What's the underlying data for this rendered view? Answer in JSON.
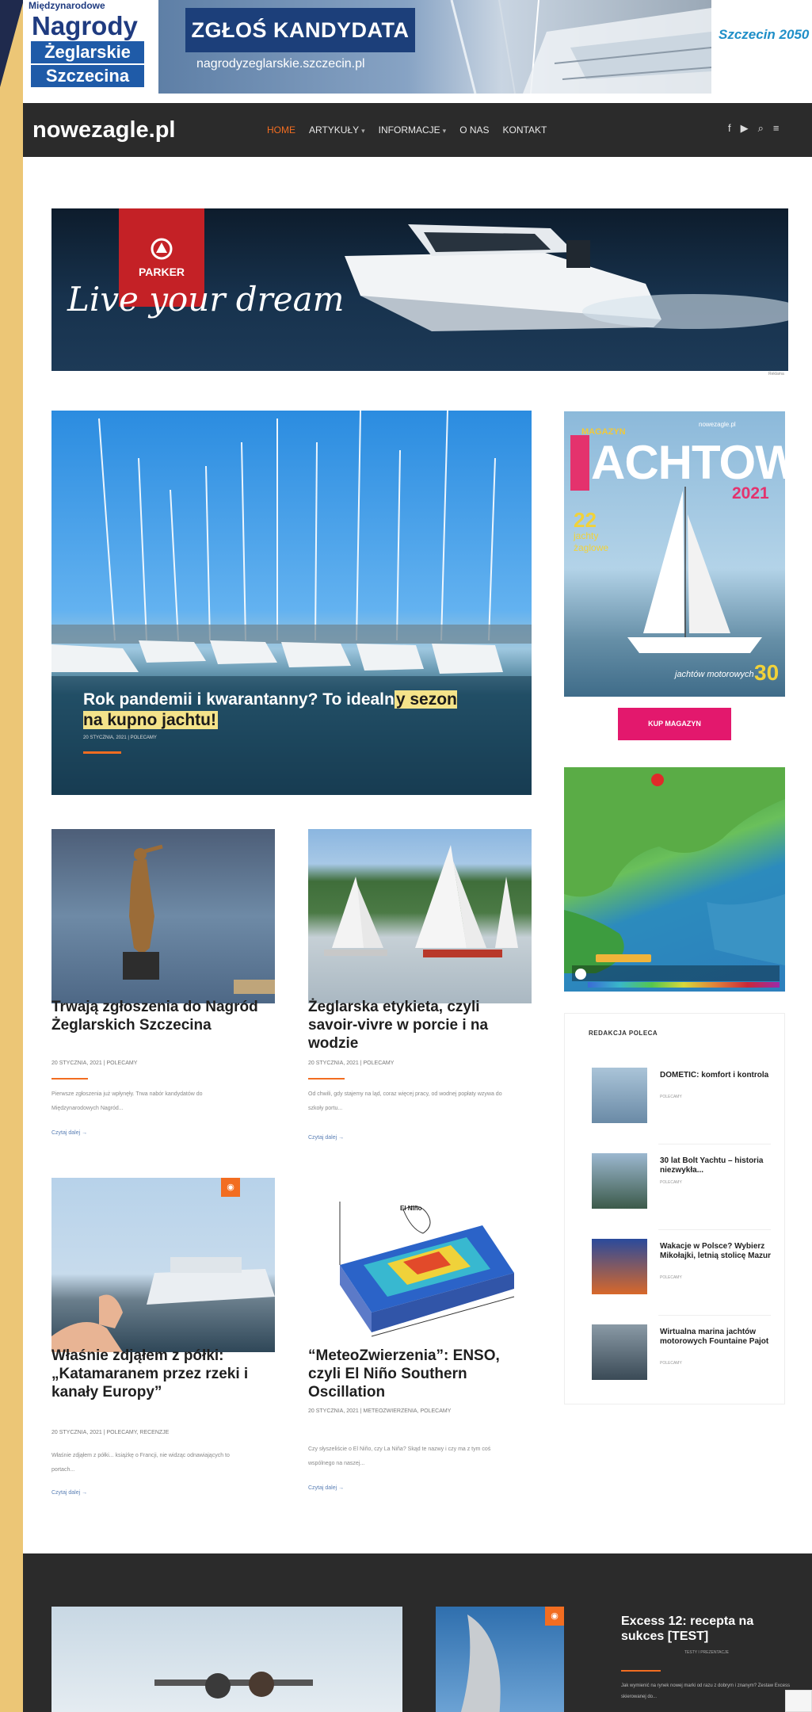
{
  "top_banner": {
    "award_small": "Międzynarodowe",
    "award_title": "Nagrody",
    "award_line2": "Żeglarskie",
    "award_line3": "Szczecina",
    "cta": "ZGŁOŚ KANDYDATA",
    "url": "nagrodyzeglarskie.szczecin.pl",
    "partner": "Szczecin 2050"
  },
  "nav": {
    "logo": "nowezagle.pl",
    "items": [
      {
        "label": "HOME",
        "active": true
      },
      {
        "label": "ARTYKUŁY",
        "dropdown": true
      },
      {
        "label": "INFORMACJE",
        "dropdown": true
      },
      {
        "label": "O NAS"
      },
      {
        "label": "KONTAKT"
      }
    ],
    "icons": [
      "facebook-icon",
      "youtube-icon",
      "search-icon",
      "menu-icon"
    ]
  },
  "ad": {
    "brand": "PARKER",
    "slogan": "Live your dream",
    "label": "Reklama"
  },
  "featured": {
    "title_plain": "Rok pandemii i kwarantanny? To idealn",
    "title_highlight": "y sezon na kupno jachtu!",
    "meta": "20 STYCZNIA, 2021  |  POLECAMY"
  },
  "cards": [
    {
      "title": "Trwają zgłoszenia do Nagród Żeglarskich Szczecina",
      "meta": "20 STYCZNIA, 2021  |  POLECAMY",
      "excerpt": "Pierwsze zgłoszenia już wpłynęły. Trwa nabór kandydatów do Międzynarodowych Nagród...",
      "more": "Czytaj dalej  →"
    },
    {
      "title": "Żeglarska etykieta, czyli savoir-vivre w porcie i na wodzie",
      "meta": "20 STYCZNIA, 2021  |  POLECAMY",
      "excerpt": "Od chwili, gdy stajemy na ląd, coraz więcej pracy, od wodnej popłaty wzywa do szkoły portu...",
      "more": "Czytaj dalej  →"
    },
    {
      "title": "Właśnie zdjąłem z półki: „Katamaranem przez rzeki i kanały Europy”",
      "meta": "20 STYCZNIA, 2021  |  POLECAMY, RECENZJE",
      "excerpt": "Właśnie zdjąłem z półki... książkę o Francji, nie widząc odnawiających to portach...",
      "more": "Czytaj dalej  →",
      "badge": "camera-icon"
    },
    {
      "title": "“MeteoZwierzenia”: ENSO, czyli El Niño Southern Oscillation",
      "meta": "20 STYCZNIA, 2021  |  METEOZWIERZENIA, POLECAMY",
      "excerpt": "Czy słyszeliście o El Niño, czy La Niña? Skąd te nazwy i czy ma z tym coś wspólnego na naszej...",
      "more": "Czytaj dalej  →",
      "diagram_label": "El Niño"
    }
  ],
  "sidebar": {
    "magazine": {
      "header": "MAGAZYN",
      "title": "ACHTOWY",
      "subtitle": "nowezagle.pl",
      "year": "2021",
      "count": "22",
      "count_label": "jachty żaglowe",
      "count2": "30",
      "count2_label": "jachtów motorowych"
    },
    "buy_button": "KUP MAGAZYN",
    "redakcja_title": "REDAKCJA POLECA",
    "recommended": [
      {
        "title": "DOMETIC: komfort i kontrola",
        "category": "POLECAMY"
      },
      {
        "title": "30 lat Bolt Yachtu – historia niezwykła...",
        "category": "POLECAMY"
      },
      {
        "title": "Wakacje w Polsce? Wybierz Mikołajki, letnią stolicę Mazur",
        "category": "POLECAMY"
      },
      {
        "title": "Wirtualna marina jachtów motorowych Fountaine Pajot",
        "category": "POLECAMY"
      }
    ]
  },
  "footer": {
    "feature_title": "Excess 12: recepta na sukces [TEST]",
    "feature_meta": "TESTY I PREZENTACJE",
    "feature_text": "Jak wymienić na rynek nowej marki od razu z dobrym i znanym? Zestaw Excess skierowanej do..."
  },
  "colors": {
    "accent": "#f26d21",
    "nav_bg": "#2b2b2b",
    "buy_button": "#e3186d",
    "highlight": "#f4e38a",
    "side_bg": "#ecc676"
  }
}
